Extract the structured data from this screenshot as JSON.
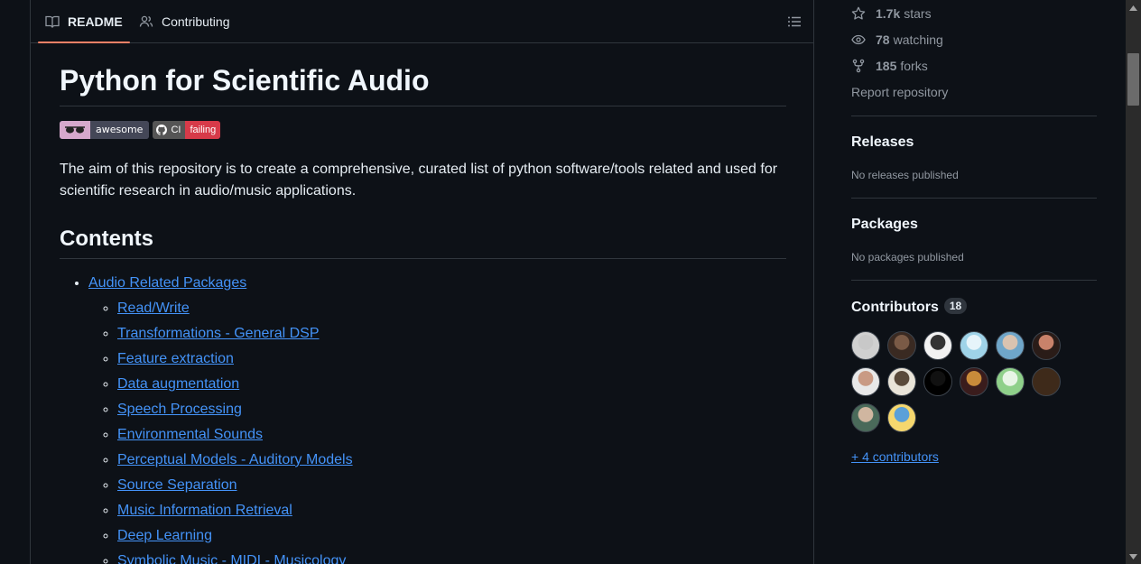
{
  "tabs": {
    "readme": "README",
    "contributing": "Contributing"
  },
  "readme": {
    "title": "Python for Scientific Audio",
    "badges": {
      "awesome": "awesome",
      "ci_label": "CI",
      "ci_status": "failing"
    },
    "description": "The aim of this repository is to create a comprehensive, curated list of python software/tools related and used for scientific research in audio/music applications.",
    "contents_heading": "Contents",
    "toc_top": "Audio Related Packages",
    "toc_items": [
      "Read/Write",
      "Transformations - General DSP",
      "Feature extraction",
      "Data augmentation",
      "Speech Processing",
      "Environmental Sounds",
      "Perceptual Models - Auditory Models",
      "Source Separation",
      "Music Information Retrieval",
      "Deep Learning",
      "Symbolic Music - MIDI - Musicology"
    ]
  },
  "sidebar": {
    "stars_value": "1.7k",
    "stars_label": "stars",
    "watching_value": "78",
    "watching_label": "watching",
    "forks_value": "185",
    "forks_label": "forks",
    "report": "Report repository",
    "releases_title": "Releases",
    "releases_note": "No releases published",
    "packages_title": "Packages",
    "packages_note": "No packages published",
    "contributors_title": "Contributors",
    "contributors_count": "18",
    "more_contributors": "+ 4 contributors"
  },
  "colors": {
    "background": "#0d1117",
    "link": "#4493f8",
    "tab_underline": "#f78166",
    "ci_failing": "#d73a49",
    "awesome_pink": "#d6a8cc"
  },
  "avatars": [
    {
      "name": "avatar-1",
      "colors": [
        "#d0d0d0",
        "#c8c8c8"
      ]
    },
    {
      "name": "avatar-2",
      "colors": [
        "#3a2a22",
        "#7a5a46"
      ]
    },
    {
      "name": "avatar-3",
      "colors": [
        "#f2f2f2",
        "#333333"
      ]
    },
    {
      "name": "avatar-4",
      "colors": [
        "#9fd3e8",
        "#e6f4fa"
      ]
    },
    {
      "name": "avatar-5",
      "colors": [
        "#6fa6c9",
        "#d9c3b0"
      ]
    },
    {
      "name": "avatar-6",
      "colors": [
        "#2a1c18",
        "#c9826a"
      ]
    },
    {
      "name": "avatar-7",
      "colors": [
        "#e8e8e8",
        "#c99a84"
      ]
    },
    {
      "name": "avatar-8",
      "colors": [
        "#e9e4d8",
        "#5a4a3a"
      ]
    },
    {
      "name": "avatar-9",
      "colors": [
        "#000000",
        "#111111"
      ]
    },
    {
      "name": "avatar-10",
      "colors": [
        "#3a1c1c",
        "#c98b3a"
      ]
    },
    {
      "name": "avatar-11",
      "colors": [
        "#8fd08a",
        "#e8f5e6"
      ]
    },
    {
      "name": "avatar-12",
      "colors": [
        "#3e2a1a",
        "#3e2a1a"
      ]
    },
    {
      "name": "avatar-13",
      "colors": [
        "#4a6a5a",
        "#d0b6a0"
      ]
    },
    {
      "name": "avatar-14",
      "colors": [
        "#f5d76e",
        "#5aa0d8"
      ]
    }
  ]
}
